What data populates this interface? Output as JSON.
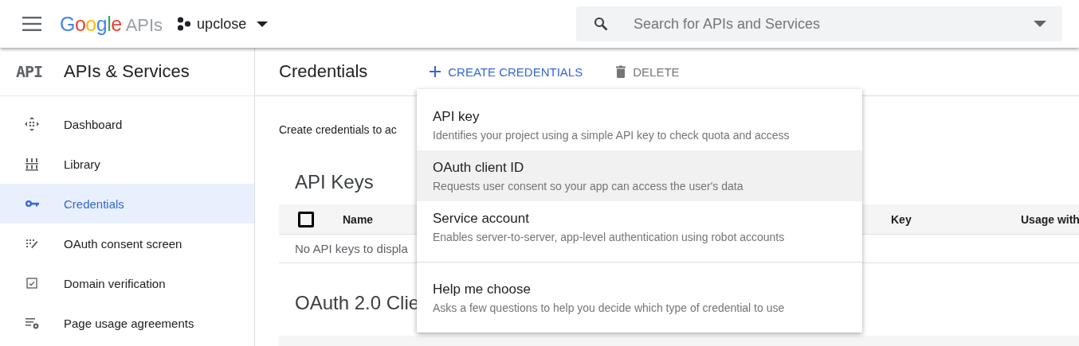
{
  "topbar": {
    "logo": "Google",
    "logo_suffix": "APIs",
    "project": "upclose",
    "search": {
      "placeholder": "Search for APIs and Services"
    }
  },
  "sidebar": {
    "badge": "API",
    "title": "APIs & Services",
    "items": [
      {
        "label": "Dashboard",
        "selected": false
      },
      {
        "label": "Library",
        "selected": false
      },
      {
        "label": "Credentials",
        "selected": true
      },
      {
        "label": "OAuth consent screen",
        "selected": false
      },
      {
        "label": "Domain verification",
        "selected": false
      },
      {
        "label": "Page usage agreements",
        "selected": false
      }
    ]
  },
  "page": {
    "title": "Credentials",
    "actions": [
      {
        "kind": "create",
        "label": "CREATE CREDENTIALS"
      },
      {
        "kind": "delete",
        "label": "DELETE"
      }
    ],
    "intro": "Create credentials to ac",
    "api_keys": {
      "title": "API Keys",
      "select_all": {
        "checked": false
      },
      "columns": [
        {
          "label": "Name"
        },
        {
          "label": "Key"
        },
        {
          "label": "Usage with"
        }
      ],
      "empty": "No API keys to displa"
    },
    "oauth": {
      "title": "OAuth 2.0 Clie"
    }
  },
  "menu": {
    "items": [
      {
        "title": "API key",
        "description": "Identifies your project using a simple API key to check quota and access",
        "selected": false,
        "divider_before": false
      },
      {
        "title": "OAuth client ID",
        "description": "Requests user consent so your app can access the user's data",
        "selected": true,
        "divider_before": false
      },
      {
        "title": "Service account",
        "description": "Enables server-to-server, app-level authentication using robot accounts",
        "selected": false,
        "divider_before": false
      },
      {
        "title": "Help me choose",
        "description": "Asks a few questions to help you decide which type of credential to use",
        "selected": false,
        "divider_before": true
      }
    ]
  }
}
